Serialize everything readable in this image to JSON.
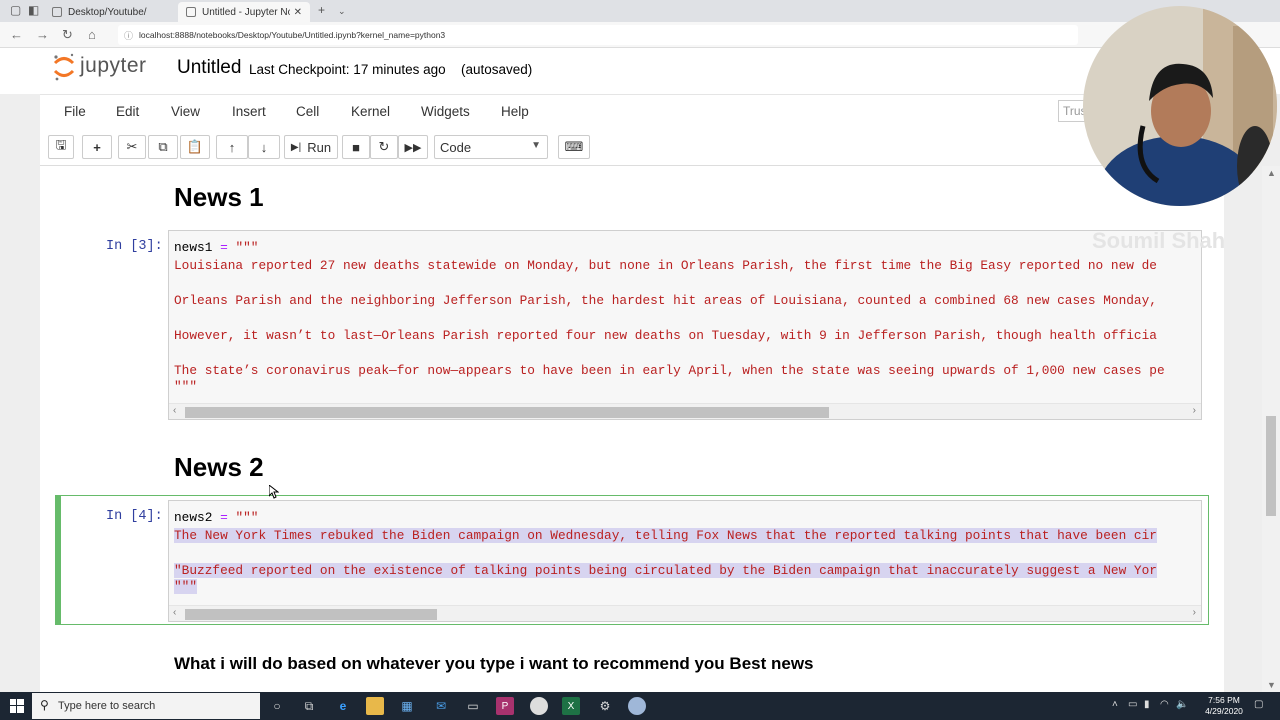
{
  "browser": {
    "tabs": [
      {
        "label": "Desktop/Youtube/"
      },
      {
        "label": "Untitled - Jupyter Notel"
      }
    ],
    "url": "localhost:8888/notebooks/Desktop/Youtube/Untitled.ipynb?kernel_name=python3"
  },
  "header": {
    "logo_text": "jupyter",
    "notebook_title": "Untitled",
    "checkpoint": "Last Checkpoint: 17 minutes ago",
    "autosave": "(autosaved)"
  },
  "menu": {
    "items": [
      "File",
      "Edit",
      "View",
      "Insert",
      "Cell",
      "Kernel",
      "Widgets",
      "Help"
    ],
    "trusted": "Trus"
  },
  "toolbar": {
    "run_label": "Run",
    "cell_type": "Code"
  },
  "notebook": {
    "cells": [
      {
        "heading": "News 1",
        "prompt": "In [3]:",
        "var": "news1",
        "op": " = ",
        "open_quote": "\"\"\"",
        "lines": [
          "Louisiana reported 27 new deaths statewide on Monday, but none in Orleans Parish, the first time the Big Easy reported no new de",
          "Orleans Parish and the neighboring Jefferson Parish, the hardest hit areas of Louisiana, counted a combined 68 new cases Monday,",
          "However, it wasn’t to last—Orleans Parish reported four new deaths on Tuesday, with 9 in Jefferson Parish, though health officia",
          "The state’s coronavirus peak—for now—appears to have been in early April, when the state was seeing upwards of 1,000 new cases pe"
        ],
        "close_quote": "\"\"\""
      },
      {
        "heading": "News 2",
        "prompt": "In [4]:",
        "var": "news2",
        "op": " = ",
        "open_quote": "\"\"\"",
        "lines": [
          "The New York Times rebuked the Biden campaign on Wednesday, telling Fox News that the reported talking points that have been cir",
          "\"Buzzfeed reported on the existence of talking points being circulated by the Biden campaign that inaccurately suggest a New Yor"
        ],
        "close_quote": "\"\"\""
      }
    ],
    "markdown_text": "What i will do based on whatever you type i want to recommend you Best news"
  },
  "overlay": {
    "watermark": "Soumil Shah"
  },
  "taskbar": {
    "search_placeholder": "Type here to search",
    "time": "7:56 PM",
    "date": "4/29/2020"
  },
  "colors": {
    "string": "#BA2121",
    "operator": "#AA22FF",
    "prompt": "#303F9F",
    "selected_cell_border": "#66bb6a",
    "jupyter_orange": "#F37726"
  }
}
